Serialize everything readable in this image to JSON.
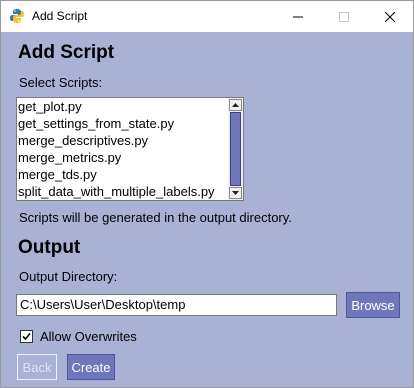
{
  "window": {
    "title": "Add Script",
    "controls": {
      "minimize": "—",
      "maximize": "☐",
      "close": "✕"
    }
  },
  "add_script": {
    "heading": "Add Script",
    "select_label": "Select Scripts:",
    "scripts": [
      "get_plot.py",
      "get_settings_from_state.py",
      "merge_descriptives.py",
      "merge_metrics.py",
      "merge_tds.py",
      "split_data_with_multiple_labels.py"
    ],
    "note": "Scripts will be generated in the output directory."
  },
  "output": {
    "heading": "Output",
    "dir_label": "Output Directory:",
    "dir_value": "C:\\Users\\User\\Desktop\\temp",
    "browse_label": "Browse",
    "allow_overwrites_label": "Allow Overwrites",
    "allow_overwrites_checked": true
  },
  "footer": {
    "back_label": "Back",
    "create_label": "Create"
  },
  "colors": {
    "background": "#a9b1d4",
    "button": "#6e78b8",
    "button_text": "#ffffff"
  }
}
